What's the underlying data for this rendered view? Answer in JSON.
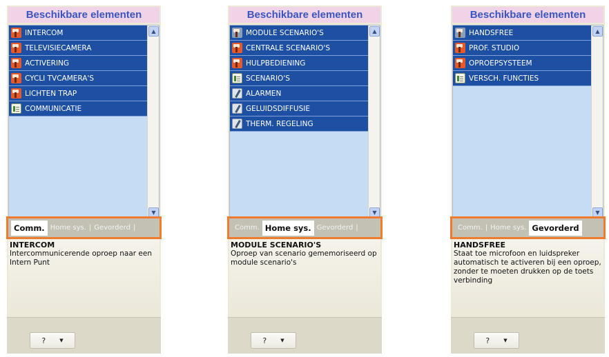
{
  "panels": [
    {
      "header": "Beschikbare elementen",
      "items": [
        {
          "label": "INTERCOM",
          "icon": "flag-icon"
        },
        {
          "label": "TELEVISIECAMERA",
          "icon": "flag-icon"
        },
        {
          "label": "ACTIVERING",
          "icon": "flag-icon"
        },
        {
          "label": "CYCLI TVCAMERA'S",
          "icon": "flag-icon"
        },
        {
          "label": "LICHTEN TRAP",
          "icon": "flag-icon"
        },
        {
          "label": "COMMUNICATIE",
          "icon": "document-icon"
        }
      ],
      "tabs": [
        {
          "label": "Comm.",
          "active": true
        },
        {
          "label": "Home sys.",
          "active": false
        },
        {
          "label": "Gevorderd",
          "active": false
        }
      ],
      "description_title": "INTERCOM",
      "description_body": "Intercommunicerende oproep naar een Intern Punt",
      "help_button": "?"
    },
    {
      "header": "Beschikbare elementen",
      "items": [
        {
          "label": "MODULE SCENARIO'S",
          "icon": "flag-icon-dim"
        },
        {
          "label": "CENTRALE  SCENARIO'S",
          "icon": "flag-icon"
        },
        {
          "label": "HULPBEDIENING",
          "icon": "flag-icon"
        },
        {
          "label": "SCENARIO'S",
          "icon": "document-icon"
        },
        {
          "label": "ALARMEN",
          "icon": "tool-icon"
        },
        {
          "label": "GELUIDSDIFFUSIE",
          "icon": "tool-icon"
        },
        {
          "label": "THERM. REGELING",
          "icon": "tool-icon"
        }
      ],
      "tabs": [
        {
          "label": "Comm.",
          "active": false
        },
        {
          "label": "Home sys.",
          "active": true
        },
        {
          "label": "Gevorderd",
          "active": false
        }
      ],
      "description_title": "MODULE SCENARIO'S",
      "description_body": "Oproep van  scenario gememoriseerd op  module scenario's",
      "help_button": "?"
    },
    {
      "header": "Beschikbare elementen",
      "items": [
        {
          "label": "HANDSFREE",
          "icon": "flag-icon-dim"
        },
        {
          "label": "PROF. STUDIO",
          "icon": "flag-icon"
        },
        {
          "label": "OPROEPSYSTEEM",
          "icon": "flag-icon"
        },
        {
          "label": "VERSCH. FUNCTIES",
          "icon": "document-icon"
        }
      ],
      "tabs": [
        {
          "label": "Comm.",
          "active": false
        },
        {
          "label": "Home sys.",
          "active": false
        },
        {
          "label": "Gevorderd",
          "active": true
        }
      ],
      "description_title": "HANDSFREE",
      "description_body": "Staat toe microfoon en luidspreker automatisch te activeren bij een oproep, zonder te moeten drukken op de toets verbinding",
      "help_button": "?"
    }
  ],
  "colors": {
    "header_bg": "#f1d3e8",
    "header_text": "#3a55c0",
    "item_bg": "#1d4fa3",
    "list_bg": "#c6dcf5",
    "highlight_outline": "#ef7b2e"
  }
}
